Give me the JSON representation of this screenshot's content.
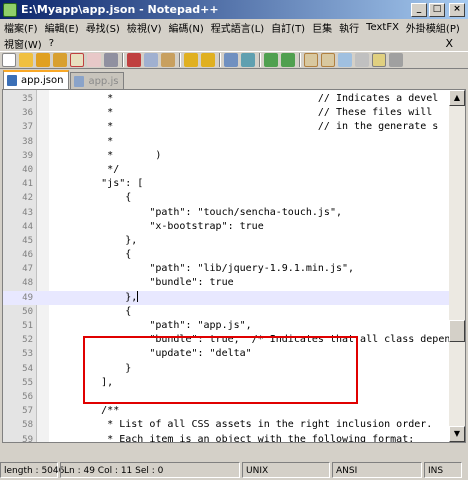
{
  "window": {
    "title": "E:\\Myapp\\app.json - Notepad++"
  },
  "menu": {
    "row1": [
      "檔案(F)",
      "編輯(E)",
      "尋找(S)",
      "檢視(V)",
      "編碼(N)",
      "程式語言(L)",
      "自訂(T)",
      "巨集",
      "執行",
      "TextFX",
      "外掛模組(P)"
    ],
    "row2": [
      "視窗(W)",
      "?"
    ],
    "close": "X"
  },
  "tabs": [
    {
      "label": "app.json",
      "active": true
    },
    {
      "label": "app.js",
      "active": false
    }
  ],
  "editor": {
    "lines": [
      {
        "num": "35",
        "text": "         *                                  // Indicates a devel"
      },
      {
        "num": "36",
        "text": "         *                                  // These files will"
      },
      {
        "num": "37",
        "text": "         *                                  // in the generate s"
      },
      {
        "num": "38",
        "text": "         *"
      },
      {
        "num": "39",
        "text": "         *       )"
      },
      {
        "num": "40",
        "text": "         */"
      },
      {
        "num": "41",
        "text": "        \"js\": ["
      },
      {
        "num": "42",
        "text": "            {"
      },
      {
        "num": "43",
        "text": "                \"path\": \"touch/sencha-touch.js\","
      },
      {
        "num": "44",
        "text": "                \"x-bootstrap\": true"
      },
      {
        "num": "45",
        "text": "            },"
      },
      {
        "num": "46",
        "text": "            {"
      },
      {
        "num": "47",
        "text": "                \"path\": \"lib/jquery-1.9.1.min.js\","
      },
      {
        "num": "48",
        "text": "                \"bundle\": true"
      },
      {
        "num": "49",
        "text": "            },"
      },
      {
        "num": "50",
        "text": "            {"
      },
      {
        "num": "51",
        "text": "                \"path\": \"app.js\","
      },
      {
        "num": "52",
        "text": "                \"bundle\": true,  /* Indicates that all class depende"
      },
      {
        "num": "53",
        "text": "                \"update\": \"delta\""
      },
      {
        "num": "54",
        "text": "            }"
      },
      {
        "num": "55",
        "text": "        ],"
      },
      {
        "num": "56",
        "text": ""
      },
      {
        "num": "57",
        "text": "        /**"
      },
      {
        "num": "58",
        "text": "         * List of all CSS assets in the right inclusion order."
      },
      {
        "num": "59",
        "text": "         * Each item is an object with the following format:"
      }
    ],
    "current_line": "49"
  },
  "status": {
    "length": "length : 5046",
    "position": "Ln : 49   Col : 11   Sel : 0",
    "eol": "UNIX",
    "encoding": "ANSI",
    "mode": "INS"
  },
  "colors": {
    "highlight_box": "#e00000",
    "current_line": "#e8e8ff"
  }
}
